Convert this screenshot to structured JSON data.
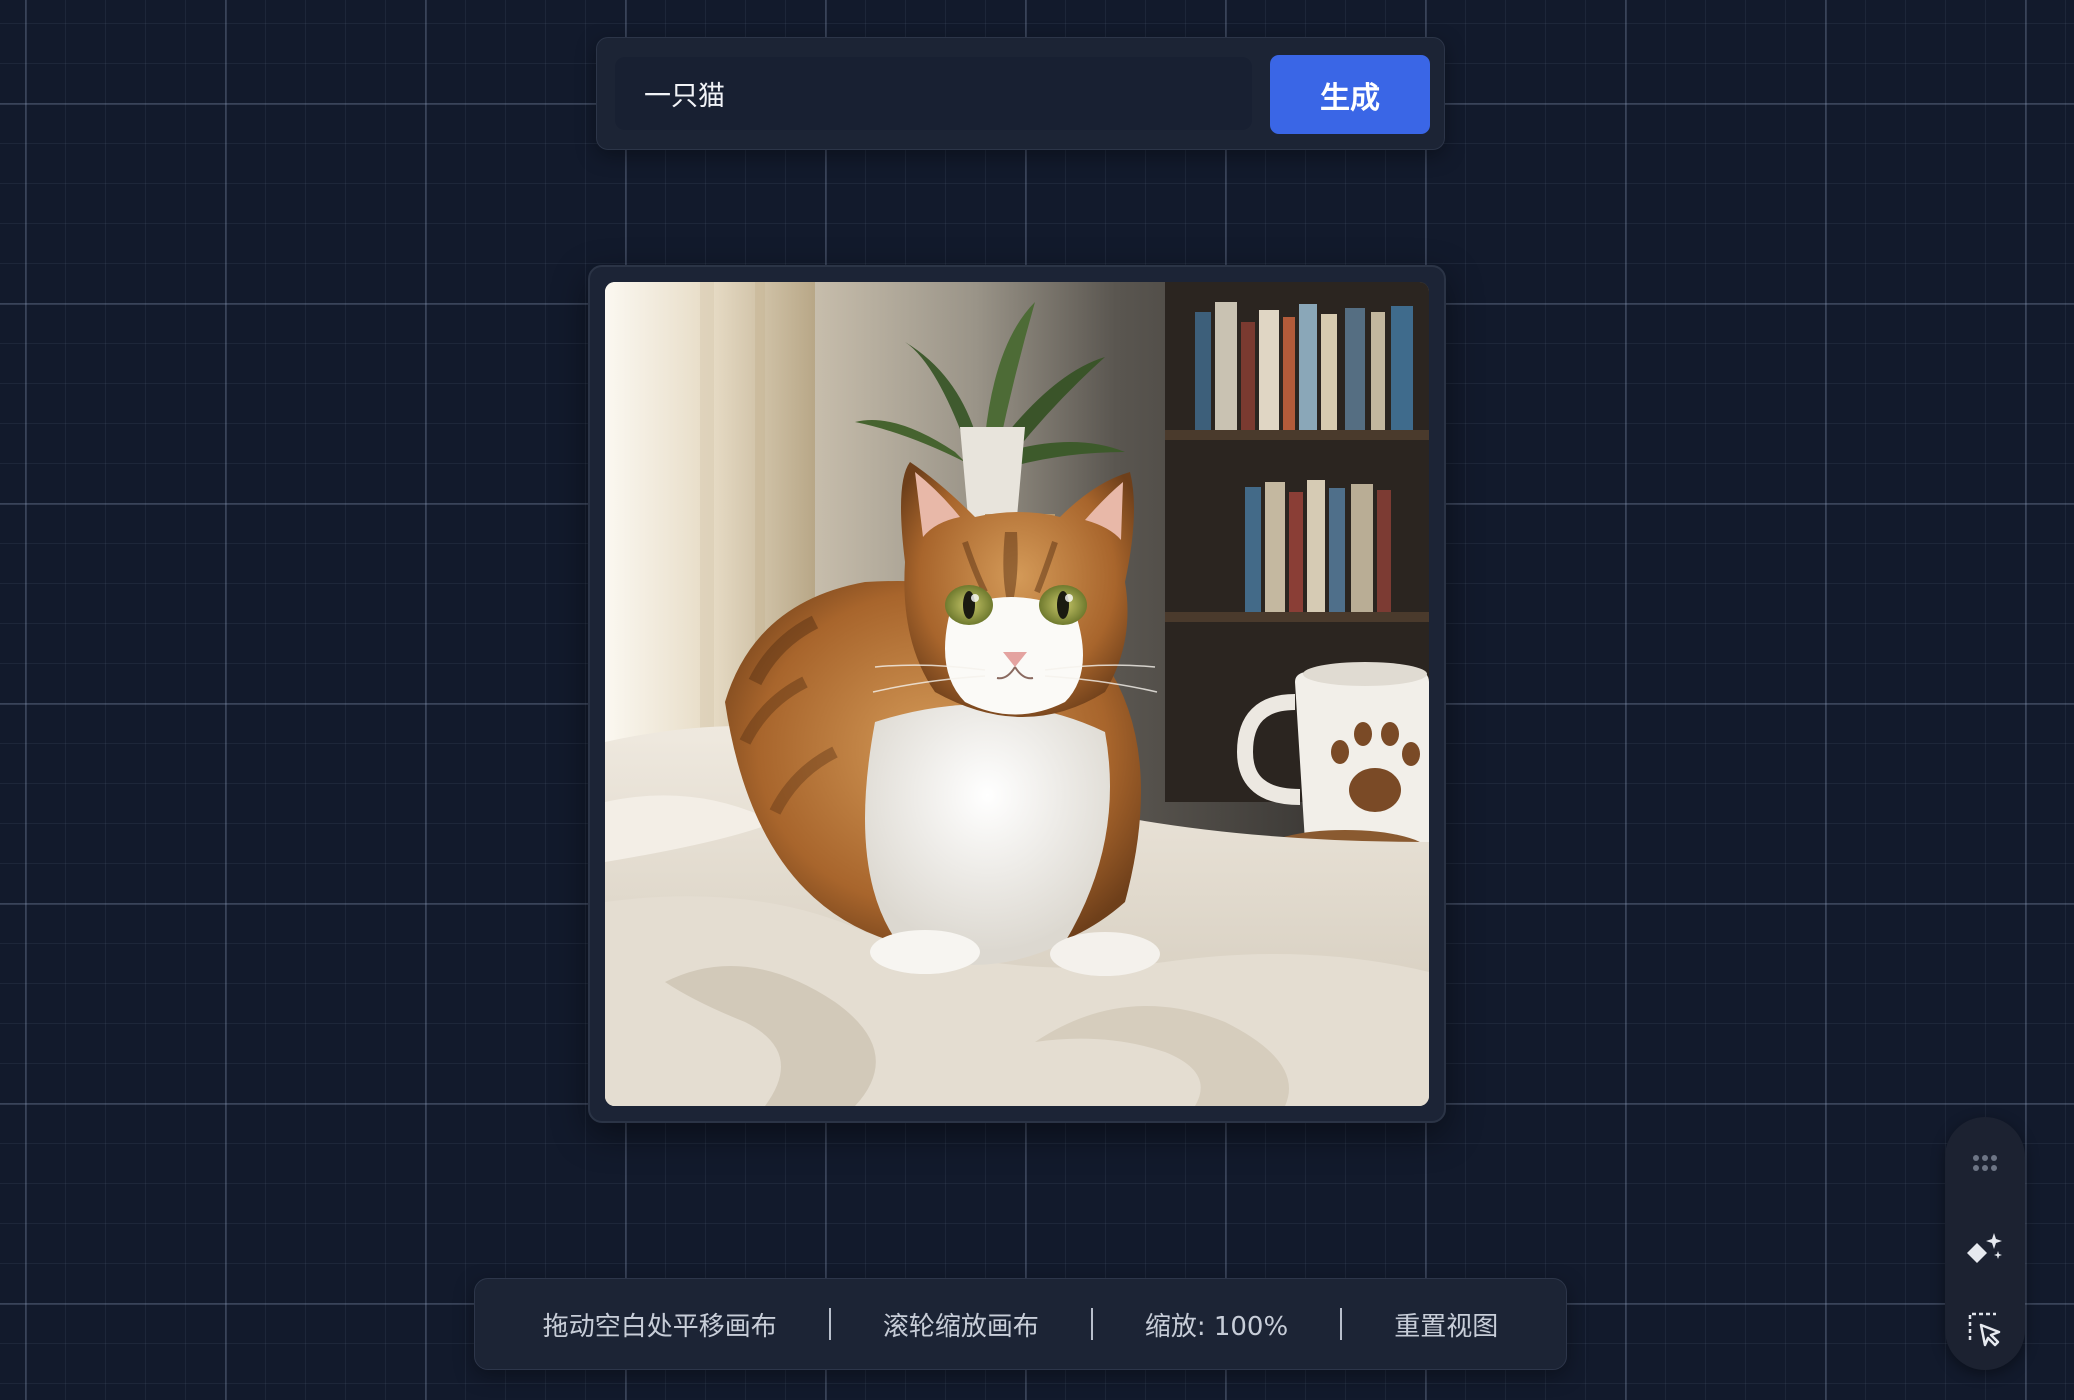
{
  "prompt": {
    "value": "一只猫",
    "generate_label": "生成"
  },
  "image": {
    "alt": "一只猫"
  },
  "status_bar": {
    "pan_hint": "拖动空白处平移画布",
    "zoom_hint": "滚轮缩放画布",
    "zoom_level": "缩放: 100%",
    "reset_view": "重置视图"
  },
  "side_toolbar": {
    "icons": [
      "grip-dots-icon",
      "magic-sparkle-icon",
      "select-cursor-icon"
    ]
  },
  "colors": {
    "canvas_background": "#121a2c",
    "panel": "#1c2435",
    "accent_button": "#3a66e6"
  }
}
